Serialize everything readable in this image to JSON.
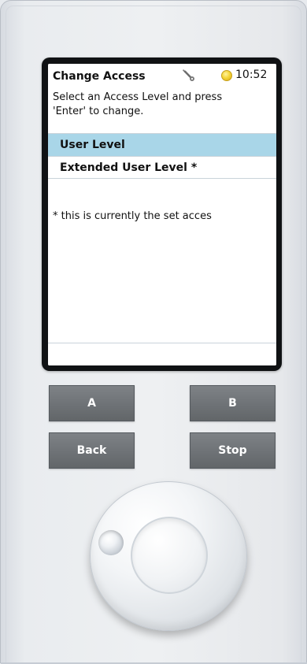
{
  "screen": {
    "title": "Change Access",
    "time": "10:52",
    "instruction_line1": "Select an Access Level and press",
    "instruction_line2": "'Enter' to change.",
    "list": [
      {
        "label": "User Level",
        "selected": true
      },
      {
        "label": "Extended User Level *",
        "selected": false
      }
    ],
    "note": "* this is currently the set acces",
    "icons": {
      "wrench": "wrench-icon",
      "status": "status-indicator"
    },
    "colors": {
      "selection": "#a9d6e8",
      "status": "#f5d63a"
    }
  },
  "buttons": {
    "a": "A",
    "b": "B",
    "back": "Back",
    "stop": "Stop"
  },
  "controls": {
    "knob": "rotary-knob"
  }
}
